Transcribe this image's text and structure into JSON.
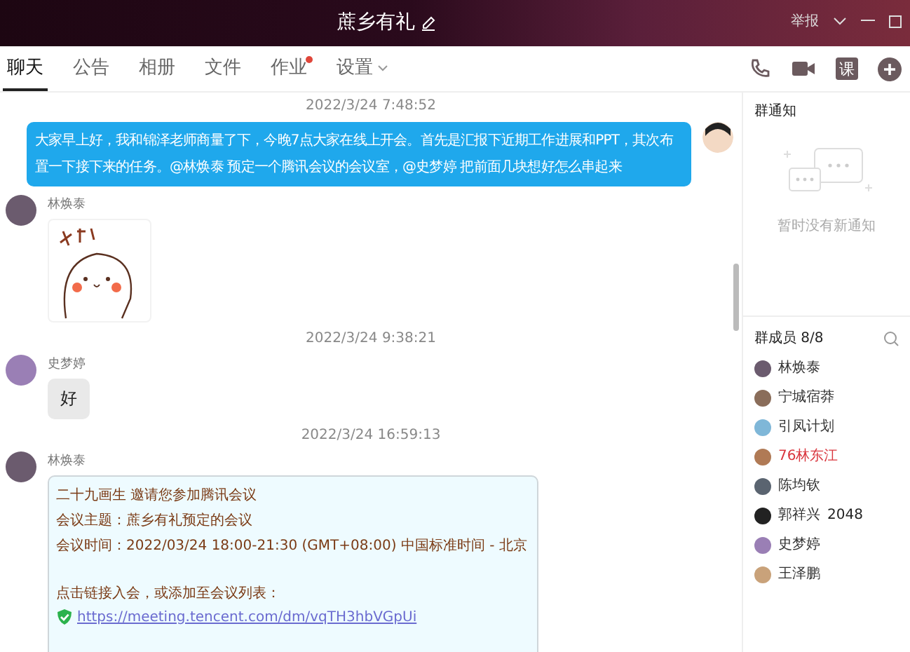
{
  "window": {
    "title": "蔗乡有礼",
    "report": "举报"
  },
  "tabs": [
    {
      "label": "聊天",
      "selected": true,
      "badge": false,
      "dropdown": false
    },
    {
      "label": "公告",
      "selected": false,
      "badge": false,
      "dropdown": false
    },
    {
      "label": "相册",
      "selected": false,
      "badge": false,
      "dropdown": false
    },
    {
      "label": "文件",
      "selected": false,
      "badge": false,
      "dropdown": false
    },
    {
      "label": "作业",
      "selected": false,
      "badge": true,
      "dropdown": false
    },
    {
      "label": "设置",
      "selected": false,
      "badge": false,
      "dropdown": true
    }
  ],
  "toolbar": {
    "lesson": "课"
  },
  "messages": [
    {
      "kind": "time",
      "text": "2022/3/24 7:48:52"
    },
    {
      "kind": "self_text",
      "text": "大家早上好，我和锦泽老师商量了下，今晚7点大家在线上开会。首先是汇报下近期工作进展和PPT，其次布置一下接下来的任务。@林焕泰 预定一个腾讯会议的会议室，@史梦婷 把前面几块想好怎么串起来"
    },
    {
      "kind": "sticker",
      "sender": "林焕泰"
    },
    {
      "kind": "time",
      "text": "2022/3/24 9:38:21"
    },
    {
      "kind": "text",
      "sender": "史梦婷",
      "text": "好"
    },
    {
      "kind": "time",
      "text": "2022/3/24 16:59:13"
    },
    {
      "kind": "invite",
      "sender": "林焕泰",
      "lines": [
        "二十九画生 邀请您参加腾讯会议",
        "会议主题：蔗乡有礼预定的会议",
        "会议时间：2022/03/24 18:00-21:30 (GMT+08:00) 中国标准时间 - 北京"
      ],
      "prompt": "点击链接入会，或添加至会议列表：",
      "link": "https://meeting.tencent.com/dm/vqTH3hbVGpUi"
    }
  ],
  "notice": {
    "title": "群通知",
    "empty": "暂时没有新通知"
  },
  "members": {
    "title": "群成员 8/8",
    "items": [
      {
        "name": "林焕泰",
        "color": "#333333"
      },
      {
        "name": "宁城宿莽",
        "color": "#333333"
      },
      {
        "name": "引凤计划",
        "color": "#333333"
      },
      {
        "name": "76林东江",
        "color": "#d9363e"
      },
      {
        "name": "陈均钦",
        "color": "#333333"
      },
      {
        "name": "郭祥兴",
        "color": "#333333",
        "extra": "2048"
      },
      {
        "name": "史梦婷",
        "color": "#333333"
      },
      {
        "name": "王泽鹏",
        "color": "#333333"
      }
    ]
  }
}
